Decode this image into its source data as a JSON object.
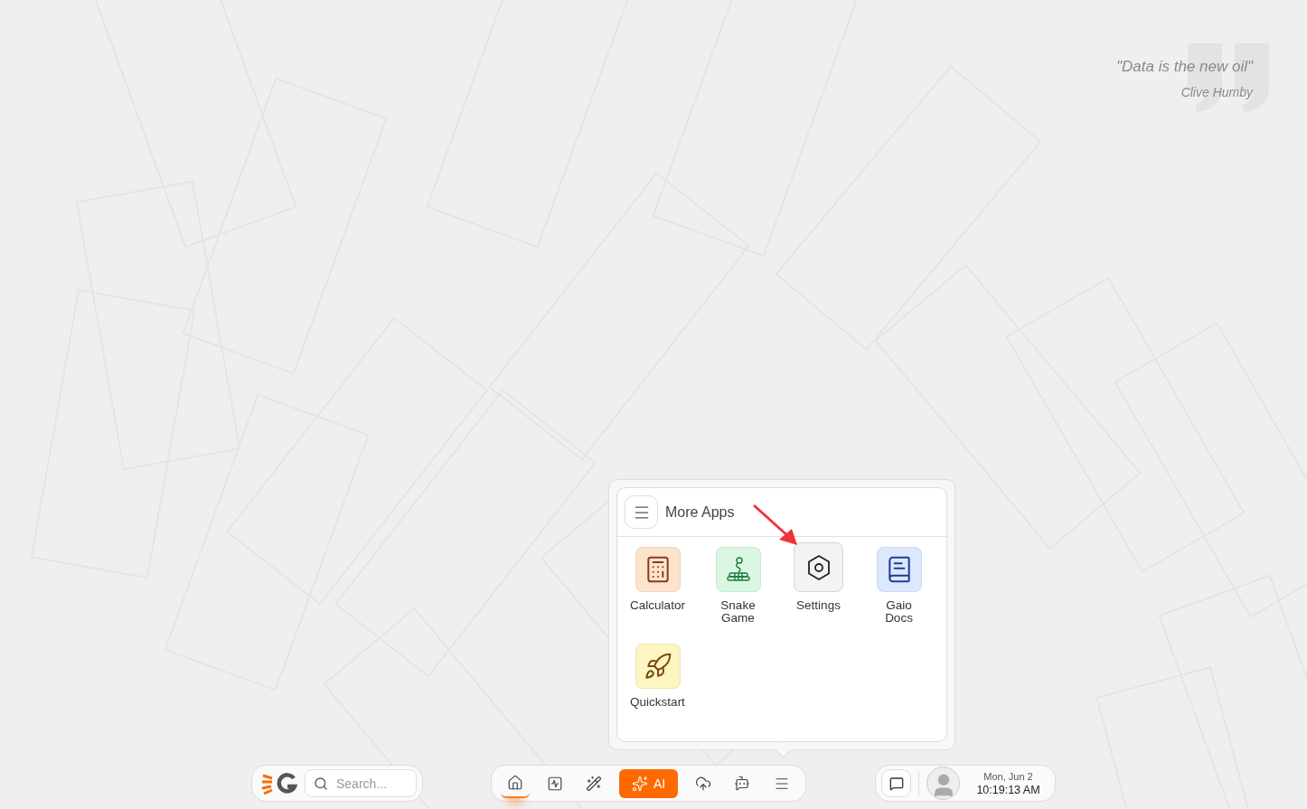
{
  "quote": {
    "text": "\"Data is the new oil\"",
    "author": "Clive Humby"
  },
  "more_apps": {
    "title": "More Apps",
    "apps": [
      {
        "kind": "calculator",
        "label": "Calculator",
        "color": "#fde3cc",
        "highlighted": false
      },
      {
        "kind": "snake",
        "label": "Snake Game",
        "color": "#d9f7e2",
        "highlighted": false
      },
      {
        "kind": "settings",
        "label": "Settings",
        "color": "#f3f3f3",
        "highlighted": true
      },
      {
        "kind": "docs",
        "label": "Gaio Docs",
        "color": "#dbe8fd",
        "highlighted": false
      },
      {
        "kind": "rocket",
        "label": "Quickstart",
        "color": "#fdf5c2",
        "highlighted": false
      }
    ]
  },
  "taskbar": {
    "search": {
      "placeholder": "Search..."
    },
    "dock": [
      {
        "kind": "home",
        "selected": true
      },
      {
        "kind": "chart",
        "selected": false
      },
      {
        "kind": "wand",
        "selected": false
      },
      {
        "kind": "ai",
        "label": "AI",
        "selected": false
      },
      {
        "kind": "upload",
        "selected": false
      },
      {
        "kind": "bot",
        "selected": false
      },
      {
        "kind": "menu",
        "selected": false
      }
    ],
    "clock": {
      "date": "Mon, Jun 2",
      "time": "10:19:13 AM"
    }
  }
}
